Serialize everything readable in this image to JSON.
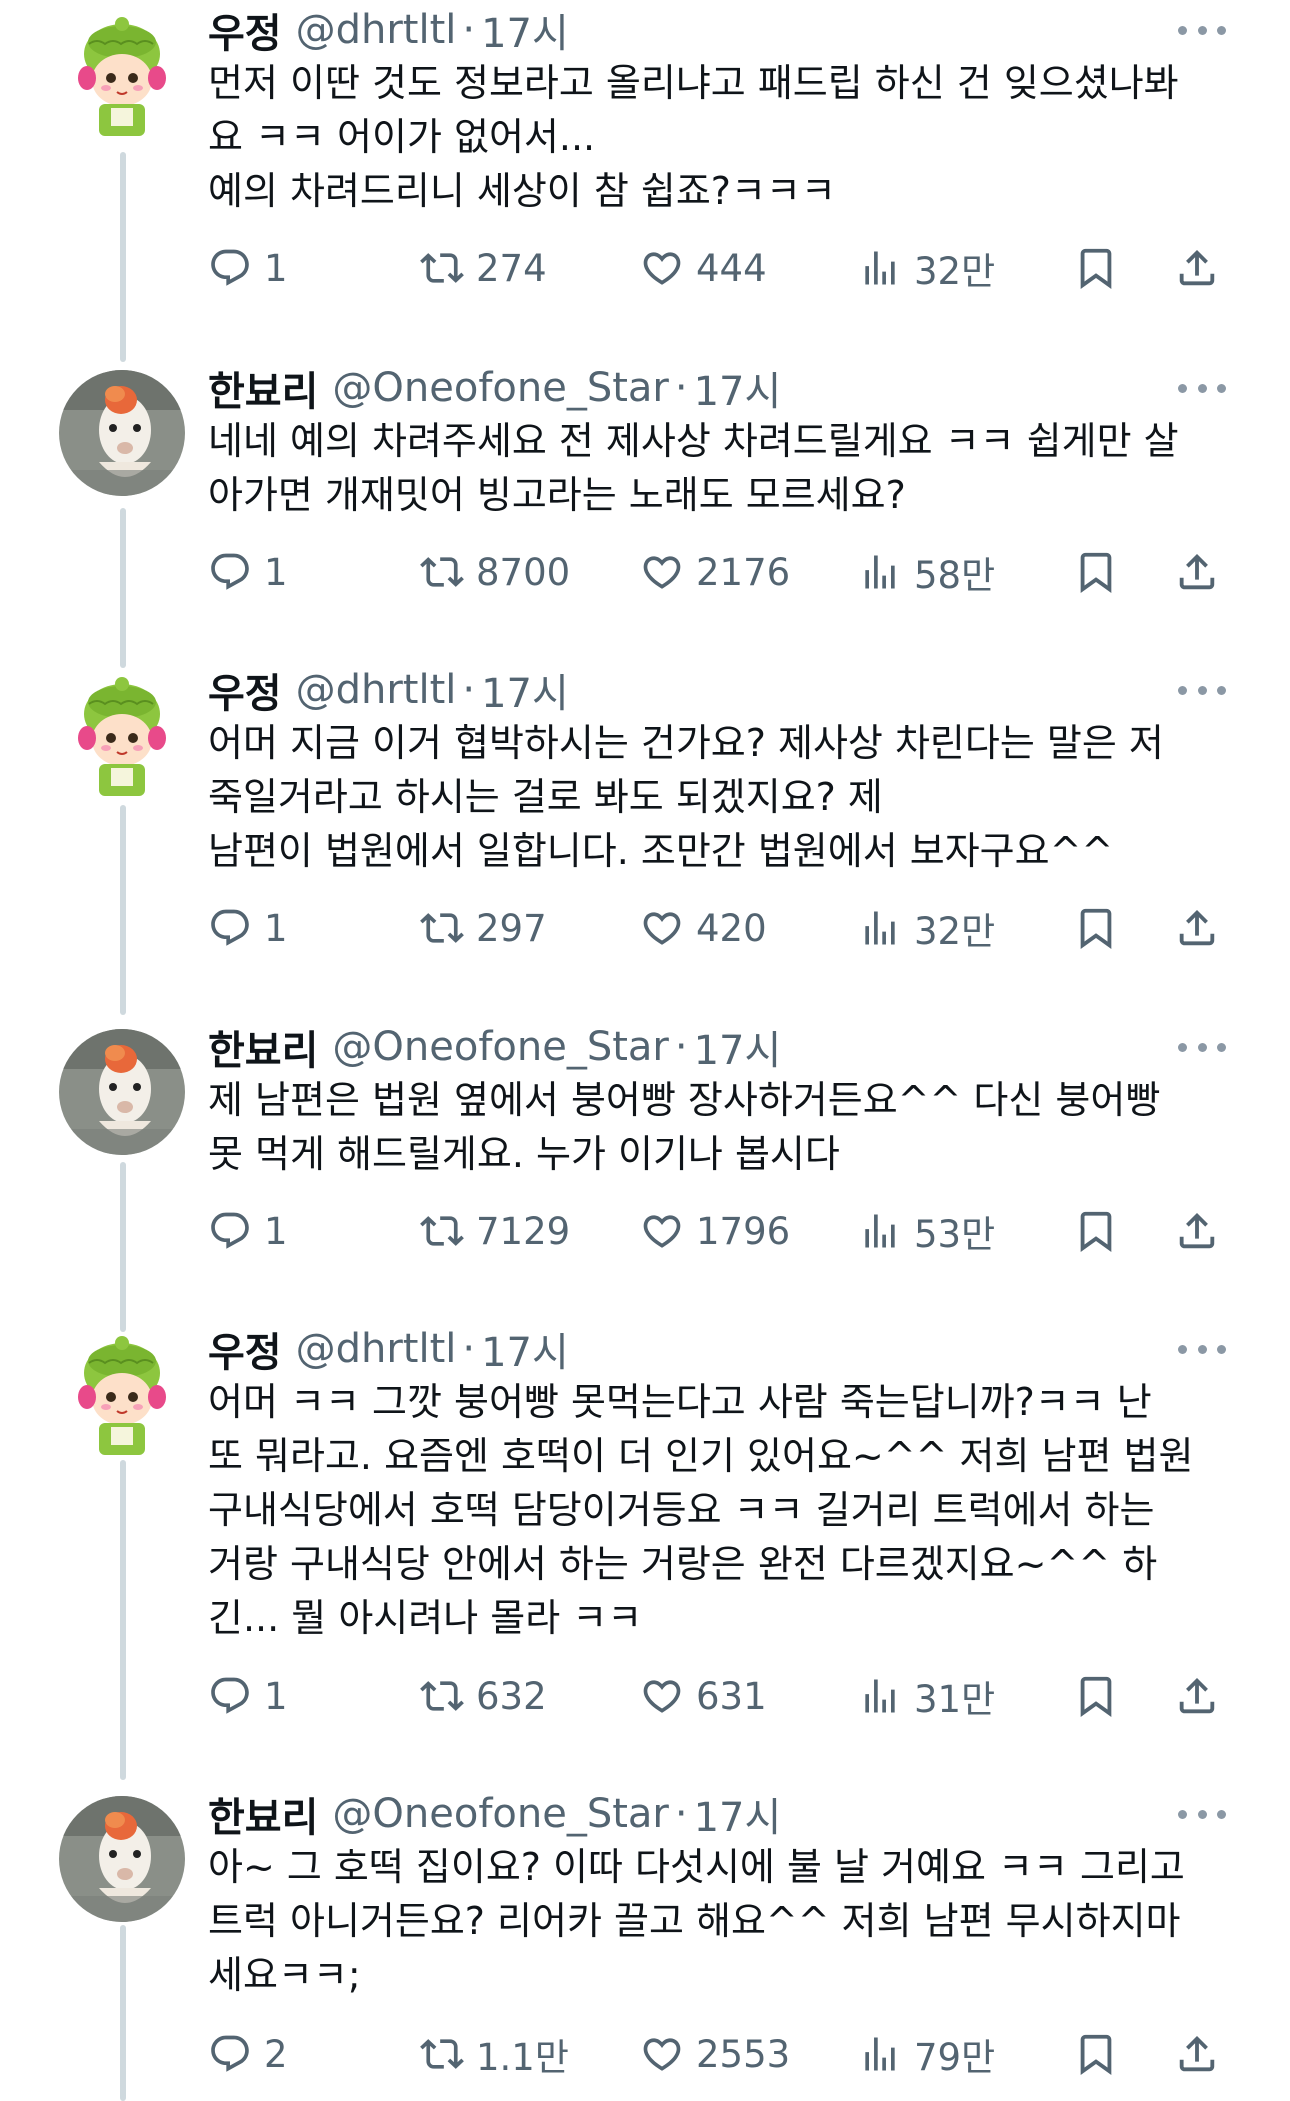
{
  "tweets": [
    {
      "author": "우정",
      "handle": "@dhrtltl",
      "time": "17시",
      "lines": [
        "먼저 이딴 것도 정보라고 올리냐고 패드립 하신 건 잊으셨나봐",
        "요 ㅋㅋ 어이가 없어서...",
        "예의 차려드리니 세상이 참 쉽죠?ㅋㅋㅋ"
      ],
      "replies": "1",
      "retweets": "274",
      "likes": "444",
      "views": "32만",
      "avatar": "green-hat-character"
    },
    {
      "author": "한뵤리",
      "handle": "@Oneofone_Star",
      "time": "17시",
      "lines": [
        "네네 예의 차려주세요 전 제사상 차려드릴게요 ㅋㅋ 쉽게만 살",
        "아가면 개재밋어 빙고라는 노래도 모르세요?"
      ],
      "replies": "1",
      "retweets": "8700",
      "likes": "2176",
      "views": "58만",
      "avatar": "goldfish-photo"
    },
    {
      "author": "우정",
      "handle": "@dhrtltl",
      "time": "17시",
      "lines": [
        "어머 지금 이거 협박하시는 건가요? 제사상 차린다는 말은 저",
        "죽일거라고 하시는 걸로 봐도 되겠지요? 제",
        "남편이 법원에서 일합니다. 조만간 법원에서 보자구요^^"
      ],
      "replies": "1",
      "retweets": "297",
      "likes": "420",
      "views": "32만",
      "avatar": "green-hat-character"
    },
    {
      "author": "한뵤리",
      "handle": "@Oneofone_Star",
      "time": "17시",
      "lines": [
        "제 남편은 법원 옆에서 붕어빵 장사하거든요^^ 다신 붕어빵",
        "못 먹게 해드릴게요. 누가 이기나 봅시다"
      ],
      "replies": "1",
      "retweets": "7129",
      "likes": "1796",
      "views": "53만",
      "avatar": "goldfish-photo"
    },
    {
      "author": "우정",
      "handle": "@dhrtltl",
      "time": "17시",
      "lines": [
        "어머 ㅋㅋ 그깟 붕어빵 못먹는다고 사람 죽는답니까?ㅋㅋ 난",
        "또 뭐라고. 요즘엔 호떡이 더 인기 있어요~^^ 저희 남편 법원",
        "구내식당에서 호떡 담당이거등요 ㅋㅋ 길거리 트럭에서 하는",
        "거랑 구내식당 안에서 하는 거랑은 완전 다르겠지요~^^ 하",
        "긴... 뭘 아시려나 몰라 ㅋㅋ"
      ],
      "replies": "1",
      "retweets": "632",
      "likes": "631",
      "views": "31만",
      "avatar": "green-hat-character"
    },
    {
      "author": "한뵤리",
      "handle": "@Oneofone_Star",
      "time": "17시",
      "lines": [
        "아~ 그 호떡 집이요? 이따 다섯시에 불 날 거예요 ㅋㅋ 그리고",
        "트럭 아니거든요? 리어카 끌고 해요^^ 저희 남편 무시하지마",
        "세요ㅋㅋ;"
      ],
      "replies": "2",
      "retweets": "1.1만",
      "likes": "2553",
      "views": "79만",
      "avatar": "goldfish-photo"
    }
  ],
  "separator": "·"
}
